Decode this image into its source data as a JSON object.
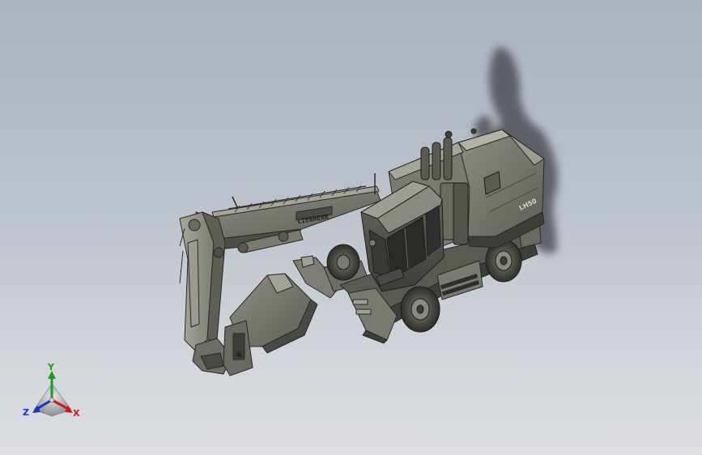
{
  "viewport": {
    "background_top": "#aab2c0",
    "background_bottom": "#dcdee2",
    "model": "wheeled-excavator",
    "boom_lettering": "LIEBHERR",
    "cab_lettering": "LH50"
  },
  "triad": {
    "x_label": "X",
    "y_label": "Y",
    "z_label": "Z",
    "x_color": "#d01818",
    "y_color": "#18a018",
    "z_color": "#1830d0"
  }
}
